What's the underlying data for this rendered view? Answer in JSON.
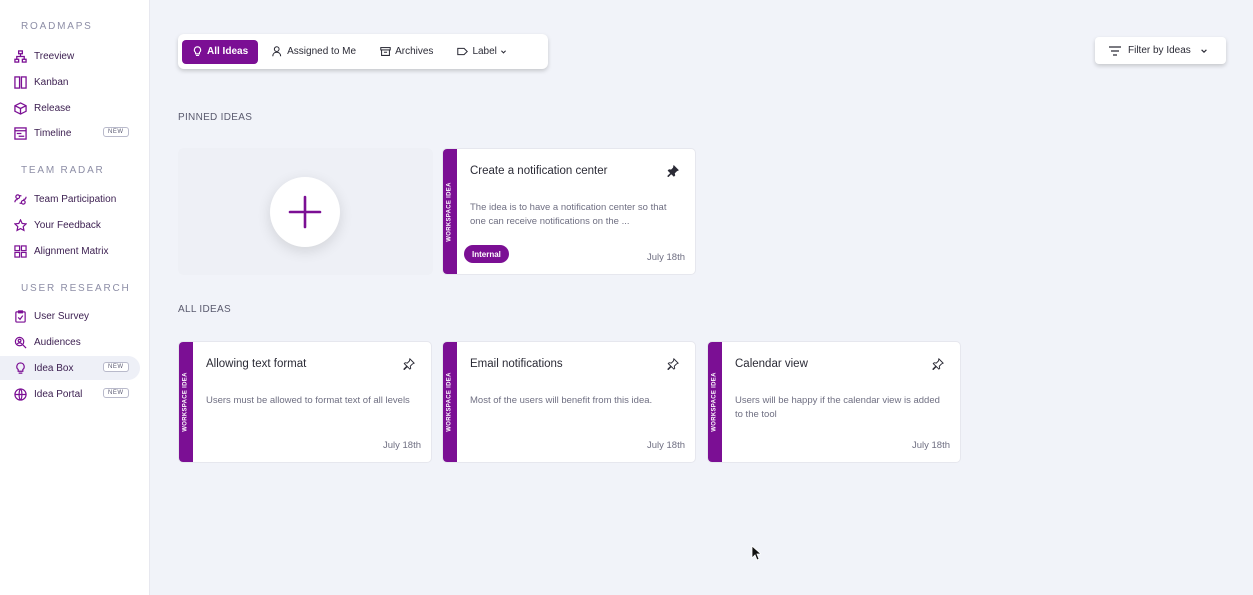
{
  "sidebar": {
    "sections": [
      {
        "title": "ROADMAPS",
        "items": [
          {
            "label": "Treeview",
            "icon": "treeview-icon"
          },
          {
            "label": "Kanban",
            "icon": "kanban-icon"
          },
          {
            "label": "Release",
            "icon": "release-icon"
          },
          {
            "label": "Timeline",
            "icon": "timeline-icon",
            "badge": "NEW"
          }
        ]
      },
      {
        "title": "TEAM RADAR",
        "items": [
          {
            "label": "Team Participation",
            "icon": "team-participation-icon"
          },
          {
            "label": "Your Feedback",
            "icon": "star-icon"
          },
          {
            "label": "Alignment Matrix",
            "icon": "matrix-icon"
          }
        ]
      },
      {
        "title": "USER RESEARCH",
        "items": [
          {
            "label": "User Survey",
            "icon": "clipboard-icon"
          },
          {
            "label": "Audiences",
            "icon": "audience-search-icon"
          },
          {
            "label": "Idea Box",
            "icon": "lightbulb-icon",
            "badge": "NEW",
            "active": true
          },
          {
            "label": "Idea Portal",
            "icon": "globe-icon",
            "badge": "NEW"
          }
        ]
      }
    ]
  },
  "toolbar": {
    "tabs": [
      {
        "label": "All Ideas",
        "icon": "lightbulb-icon",
        "active": true
      },
      {
        "label": "Assigned to Me",
        "icon": "user-icon"
      },
      {
        "label": "Archives",
        "icon": "archive-icon"
      },
      {
        "label": "Label",
        "icon": "tag-icon"
      }
    ],
    "filter_label": "Filter by Ideas"
  },
  "pinned": {
    "heading": "PINNED IDEAS",
    "cards": [
      {
        "strip": "WORKSPACE IDEA",
        "title": "Create a notification center",
        "description": "The idea is to have a notification center so that one can receive notifications on the ...",
        "label": "Internal",
        "date": "July 18th",
        "pinned": true
      }
    ]
  },
  "all": {
    "heading": "ALL IDEAS",
    "cards": [
      {
        "strip": "WORKSPACE IDEA",
        "title": "Allowing text format",
        "description": "Users must be allowed to format text of all levels",
        "date": "July 18th",
        "pinned": false
      },
      {
        "strip": "WORKSPACE IDEA",
        "title": "Email notifications",
        "description": "Most of the users will  benefit from this idea.",
        "date": "July 18th",
        "pinned": false
      },
      {
        "strip": "WORKSPACE IDEA",
        "title": "Calendar view",
        "description": "Users will be happy if the calendar view is added to the tool",
        "date": "July 18th",
        "pinned": false
      }
    ]
  },
  "colors": {
    "accent": "#7b0f94",
    "background": "#f1f3f9"
  }
}
